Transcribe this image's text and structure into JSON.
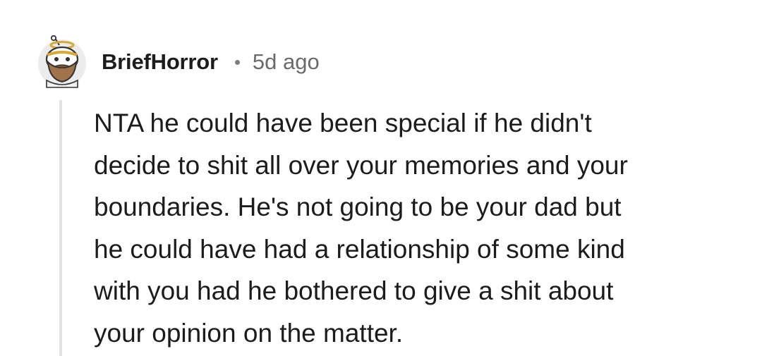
{
  "comment": {
    "username": "BriefHorror",
    "timestamp": "5d ago",
    "avatar_icon": "snoo-avatar-icon",
    "body_lines": [
      "NTA he could have been special if he didn't",
      "decide to shit all over your memories and your",
      "boundaries. He's not going to be your dad but",
      "he could have had a relationship of some kind",
      "with you had he bothered to give a shit about",
      "your opinion on the matter."
    ]
  },
  "colors": {
    "text": "#1c1c1c",
    "meta": "#6a6a6a",
    "thread_line": "#e3e3e3",
    "background": "#ffffff"
  }
}
